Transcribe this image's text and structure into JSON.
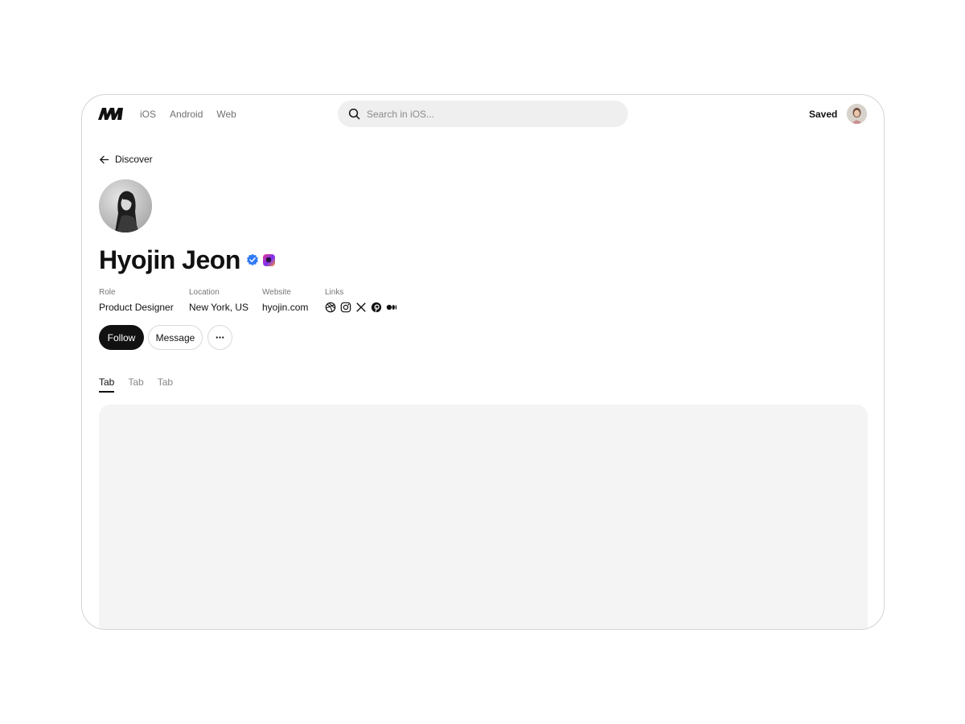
{
  "nav": {
    "logo_icon": "brand-m-logo-icon",
    "links": [
      {
        "label": "iOS"
      },
      {
        "label": "Android"
      },
      {
        "label": "Web"
      }
    ],
    "search": {
      "placeholder": "Search in iOS...",
      "value": "",
      "icon": "search-icon"
    },
    "saved_label": "Saved",
    "user_avatar": "user-avatar"
  },
  "back": {
    "label": "Discover",
    "icon": "arrow-left-icon"
  },
  "profile": {
    "name": "Hyojin Jeon",
    "verified_icon": "verified-badge-icon",
    "verified_color": "#2f7bf5",
    "info": {
      "role": {
        "label": "Role",
        "value": "Product Designer"
      },
      "location": {
        "label": "Location",
        "value": "New York, US"
      },
      "website": {
        "label": "Website",
        "value": "hyojin.com"
      },
      "links": {
        "label": "Links",
        "icons": [
          "dribbble-icon",
          "instagram-icon",
          "x-icon",
          "pinterest-icon",
          "medium-icon"
        ]
      }
    },
    "actions": {
      "follow": "Follow",
      "message": "Message",
      "more_icon": "more-horizontal-icon"
    }
  },
  "tabs": [
    {
      "label": "Tab",
      "active": true
    },
    {
      "label": "Tab",
      "active": false
    },
    {
      "label": "Tab",
      "active": false
    }
  ],
  "colors": {
    "primary": "#111111",
    "search_bg": "#efefef",
    "content_bg": "#f4f4f4",
    "border": "#d4d4d4"
  }
}
